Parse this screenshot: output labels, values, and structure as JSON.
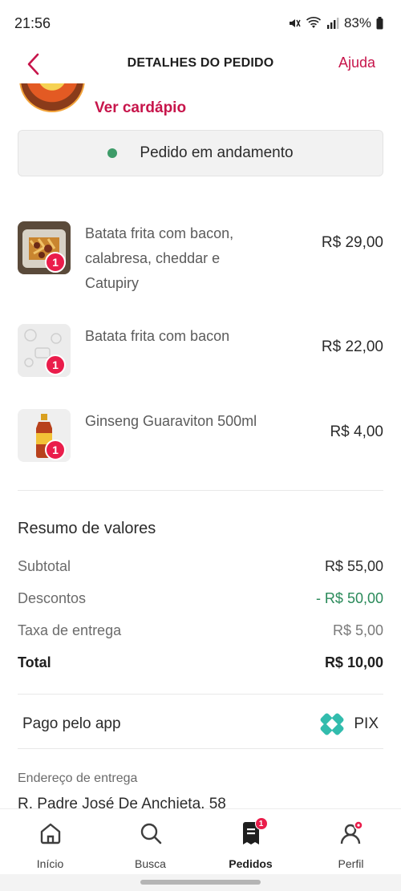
{
  "status_bar": {
    "time": "21:56",
    "battery": "83%"
  },
  "header": {
    "title": "DETALHES DO PEDIDO",
    "help_label": "Ajuda"
  },
  "restaurant": {
    "menu_link": "Ver cardápio"
  },
  "order_status": {
    "text": "Pedido em andamento",
    "dot_color": "#3e9c69"
  },
  "items": [
    {
      "name": "Batata frita com bacon, calabresa, cheddar e Catupiry",
      "price": "R$ 29,00",
      "qty": "1"
    },
    {
      "name": "Batata frita com bacon",
      "price": "R$ 22,00",
      "qty": "1"
    },
    {
      "name": "Ginseng Guaraviton 500ml",
      "price": "R$ 4,00",
      "qty": "1"
    }
  ],
  "summary": {
    "title": "Resumo de valores",
    "subtotal_label": "Subtotal",
    "subtotal_value": "R$ 55,00",
    "discounts_label": "Descontos",
    "discounts_value": "- R$ 50,00",
    "fee_label": "Taxa de entrega",
    "fee_value": "R$ 5,00",
    "total_label": "Total",
    "total_value": "R$ 10,00"
  },
  "payment": {
    "label": "Pago pelo app",
    "method": "PIX"
  },
  "address": {
    "label": "Endereço de entrega",
    "value": "R. Padre José De Anchieta, 58"
  },
  "nav": [
    {
      "label": "Início",
      "icon": "home-icon"
    },
    {
      "label": "Busca",
      "icon": "search-icon"
    },
    {
      "label": "Pedidos",
      "icon": "orders-icon",
      "badge": "1"
    },
    {
      "label": "Perfil",
      "icon": "profile-icon"
    }
  ],
  "colors": {
    "brand": "#ea1d4b",
    "link": "#c7154b",
    "discount": "#2a8a5a",
    "pix": "#32bcad"
  }
}
